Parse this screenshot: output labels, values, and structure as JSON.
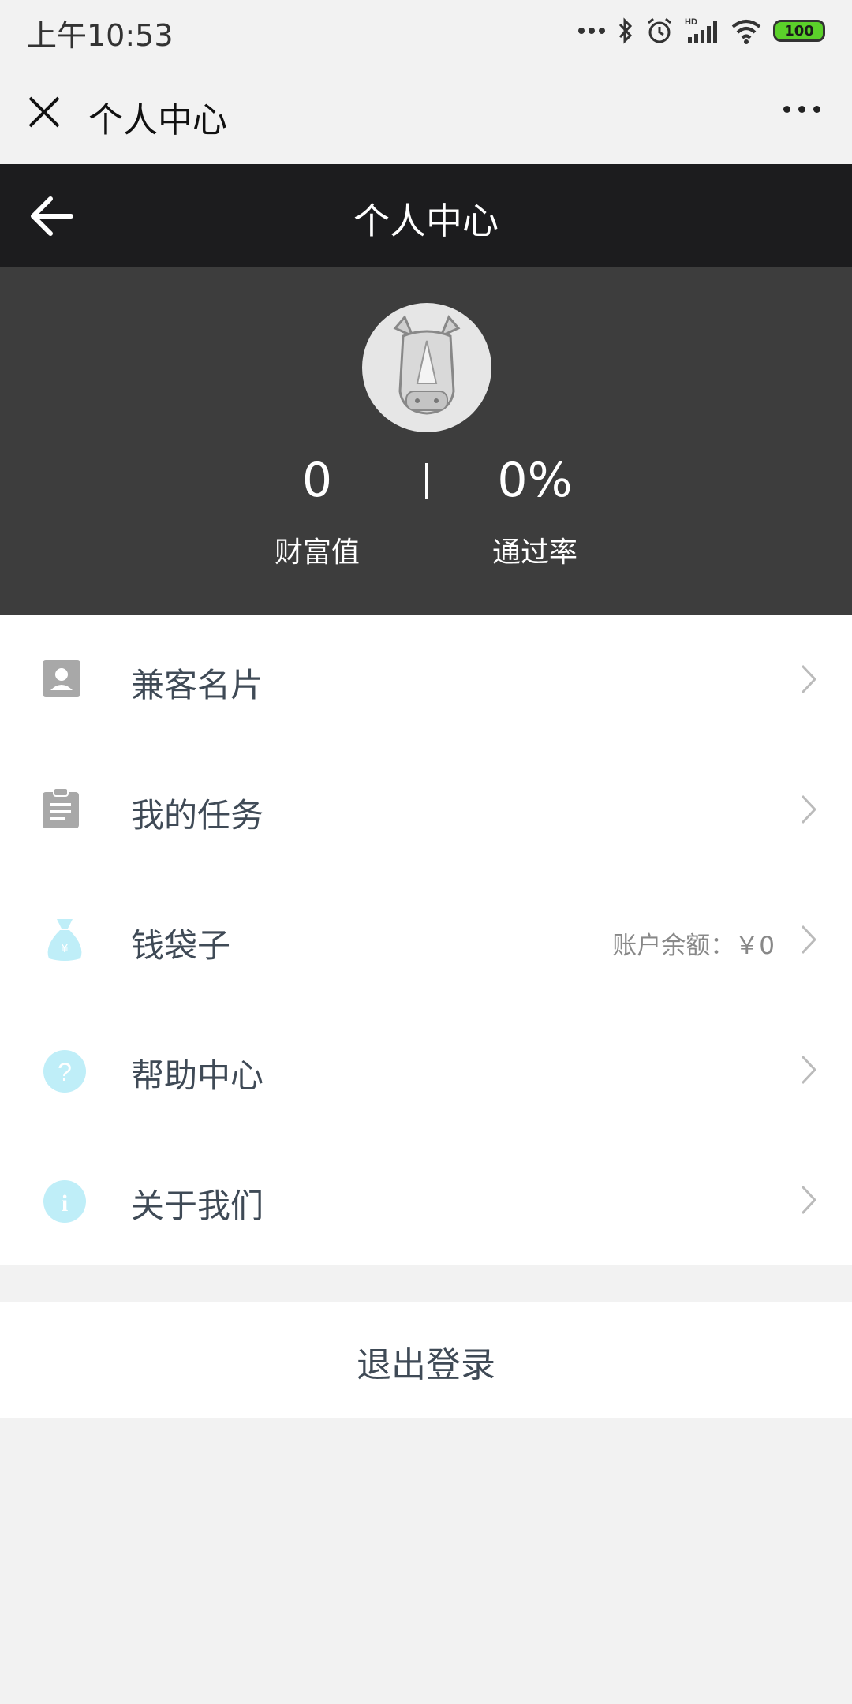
{
  "status_bar": {
    "time": "上午10:53",
    "battery": "100",
    "icons": [
      "dots-icon",
      "bluetooth-icon",
      "alarm-icon",
      "signal-hd-icon",
      "wifi-icon",
      "battery-icon"
    ]
  },
  "wechat_bar": {
    "title": "个人中心",
    "close_icon": "close-icon",
    "more_icon": "more-icon"
  },
  "header": {
    "title": "个人中心",
    "back_icon": "back-arrow-icon"
  },
  "profile": {
    "wealth_value": "0",
    "wealth_label": "财富值",
    "pass_rate_value": "0%",
    "pass_rate_label": "通过率"
  },
  "menu": {
    "items": [
      {
        "label": "兼客名片",
        "icon": "contact-card-icon",
        "extra": ""
      },
      {
        "label": "我的任务",
        "icon": "clipboard-icon",
        "extra": ""
      },
      {
        "label": "钱袋子",
        "icon": "money-bag-icon",
        "extra": "账户余额：￥0"
      },
      {
        "label": "帮助中心",
        "icon": "help-icon",
        "extra": ""
      },
      {
        "label": "关于我们",
        "icon": "info-icon",
        "extra": ""
      }
    ]
  },
  "logout_label": "退出登录",
  "colors": {
    "header_bg": "#1c1c1e",
    "profile_bg": "#3d3d3d",
    "accent_light_blue": "#bfeef8",
    "page_bg": "#f2f2f2"
  }
}
